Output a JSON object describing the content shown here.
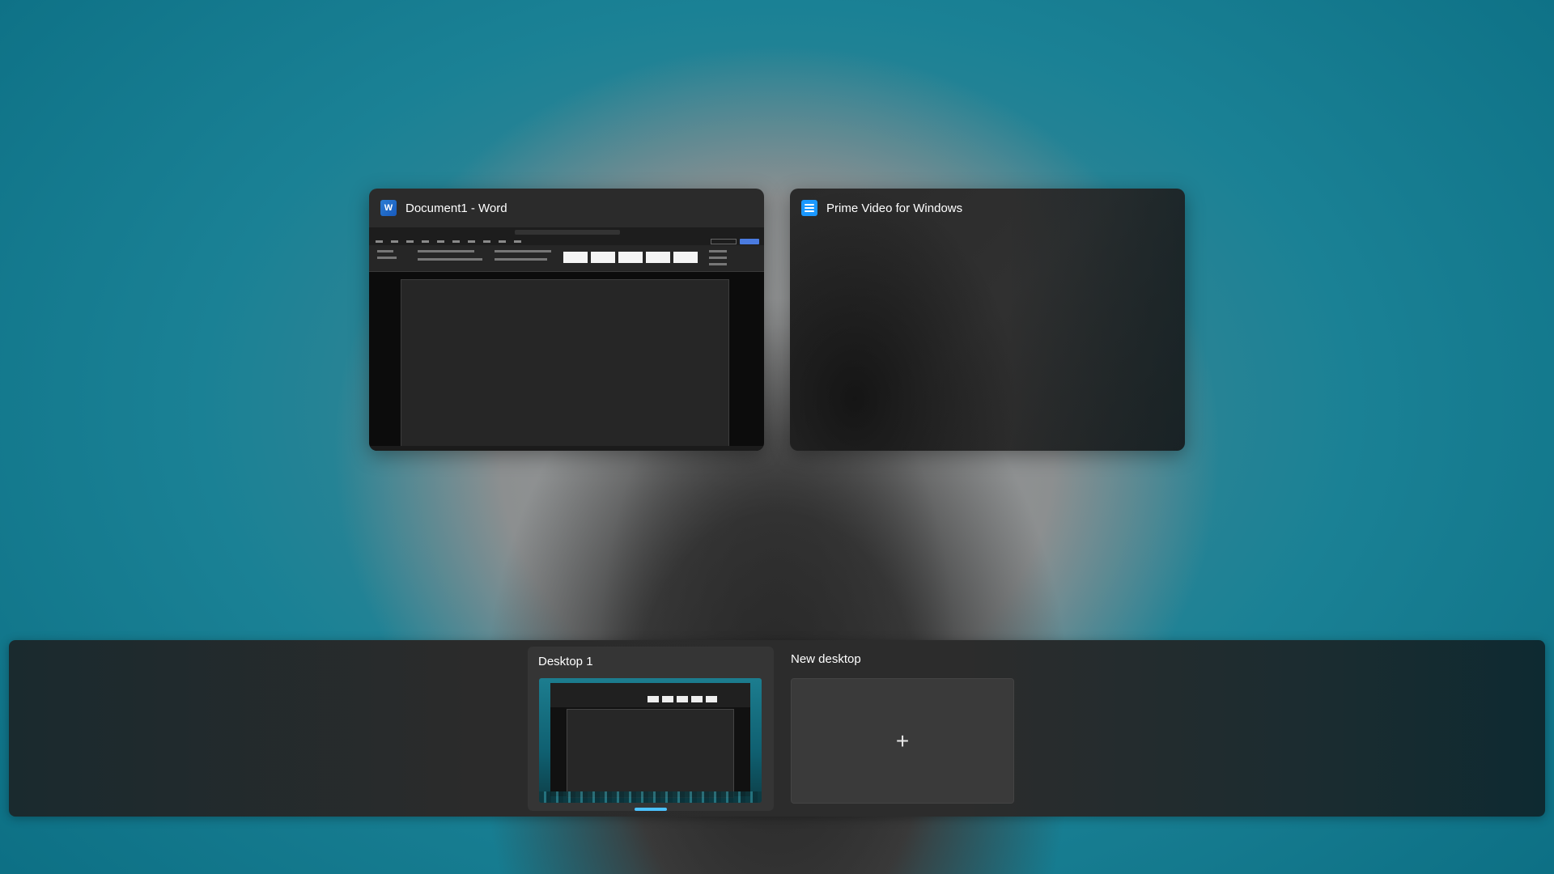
{
  "windows": [
    {
      "title": "Document1 - Word",
      "icon": "word-icon"
    },
    {
      "title": "Prime Video for Windows",
      "icon": "prime-video-icon"
    }
  ],
  "desktops": {
    "current": {
      "label": "Desktop 1"
    },
    "new": {
      "label": "New desktop",
      "plus": "+"
    }
  },
  "colors": {
    "accent": "#4cc2ff",
    "word_brand": "#185abd",
    "prime_brand": "#1a98ff"
  }
}
